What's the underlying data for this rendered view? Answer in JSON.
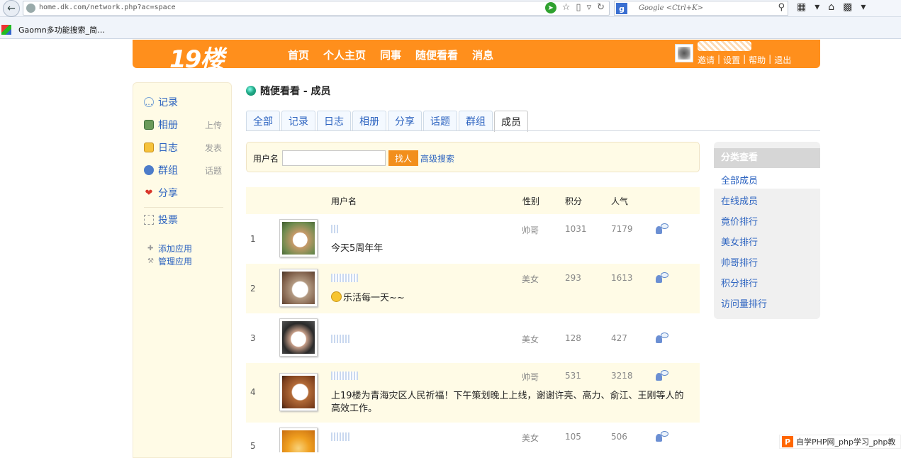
{
  "browser": {
    "url": "home.dk.com/network.php?ac=space",
    "search_placeholder": "Google <Ctrl+K>",
    "bookmark": "Gaomn多功能搜索_简…"
  },
  "site": {
    "logo": "19楼",
    "menu": [
      "首页",
      "个人主页",
      "同事",
      "随便看看",
      "消息"
    ],
    "user_links": [
      "邀请",
      "|",
      "设置",
      "|",
      "帮助",
      "|",
      "退出"
    ]
  },
  "sidebar": {
    "items": [
      {
        "label": "记录",
        "aux": ""
      },
      {
        "label": "相册",
        "aux": "上传"
      },
      {
        "label": "日志",
        "aux": "发表"
      },
      {
        "label": "群组",
        "aux": "话题"
      },
      {
        "label": "分享",
        "aux": ""
      },
      {
        "label": "投票",
        "aux": ""
      }
    ],
    "add_app": "添加应用",
    "manage_app": "管理应用"
  },
  "page": {
    "title": "随便看看 - 成员",
    "tabs": [
      "全部",
      "记录",
      "日志",
      "相册",
      "分享",
      "话题",
      "群组",
      "成员"
    ],
    "active_tab": "成员"
  },
  "search": {
    "label": "用户名",
    "value": "",
    "button": "找人",
    "advanced": "高级搜索"
  },
  "table": {
    "headers": {
      "username": "用户名",
      "gender": "性别",
      "points": "积分",
      "popularity": "人气"
    },
    "rows": [
      {
        "num": "1",
        "status": "今天5周年年",
        "gender": "帅哥",
        "points": "1031",
        "popularity": "7179"
      },
      {
        "num": "2",
        "status": "乐活每一天~~",
        "gender": "美女",
        "points": "293",
        "popularity": "1613"
      },
      {
        "num": "3",
        "status": "",
        "gender": "美女",
        "points": "128",
        "popularity": "427"
      },
      {
        "num": "4",
        "status": "上19楼为青海灾区人民祈福！下午策划晚上上线，谢谢许亮、高力、俞江、王刚等人的高效工作。",
        "gender": "帅哥",
        "points": "531",
        "popularity": "3218"
      },
      {
        "num": "5",
        "status": "",
        "gender": "美女",
        "points": "105",
        "popularity": "506"
      }
    ]
  },
  "right_panel": {
    "title": "分类查看",
    "links": [
      "全部成员",
      "在线成员",
      "竟价排行",
      "美女排行",
      "帅哥排行",
      "积分排行",
      "访问量排行"
    ]
  },
  "watermark": "自学PHP网_php学习_php教"
}
